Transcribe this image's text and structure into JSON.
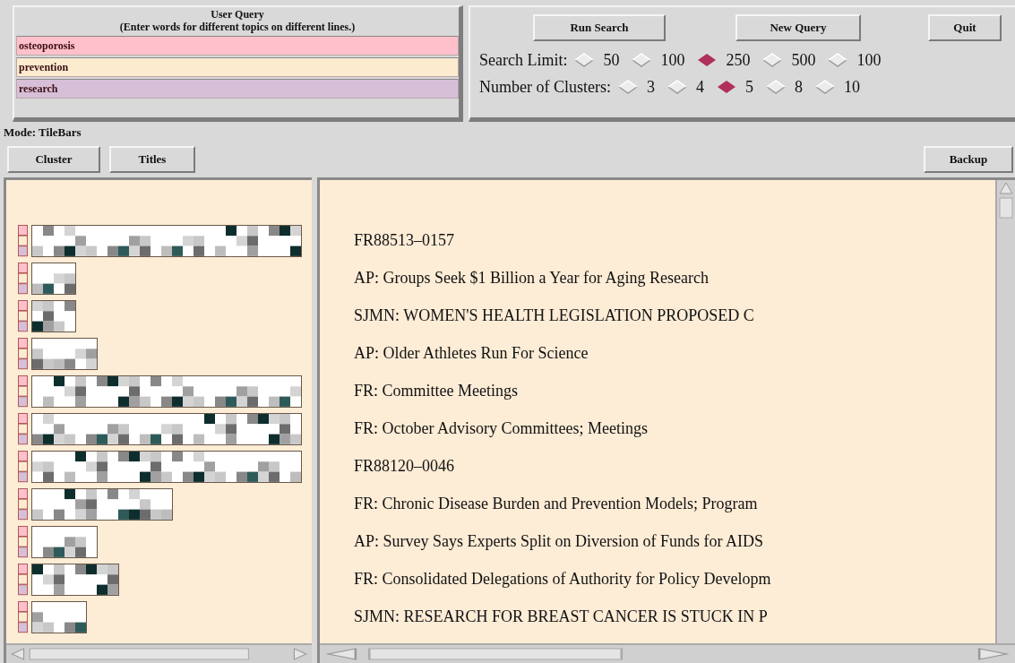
{
  "query_panel": {
    "title": "User Query",
    "hint": "(Enter words for different topics on different lines.)",
    "terms": [
      {
        "value": "osteoporosis",
        "color": "#ffc0cb"
      },
      {
        "value": "prevention",
        "color": "#fdebd0"
      },
      {
        "value": "research",
        "color": "#d8bfd8"
      }
    ]
  },
  "buttons": [
    "Run Search",
    "New Query",
    "Quit"
  ],
  "search_limit": {
    "label": "Search Limit:",
    "options": [
      {
        "label": "50",
        "selected": false
      },
      {
        "label": "100",
        "selected": false
      },
      {
        "label": "250",
        "selected": true
      },
      {
        "label": "500",
        "selected": false
      },
      {
        "label": "100",
        "selected": false
      }
    ]
  },
  "clusters": {
    "label": "Number of Clusters:",
    "options": [
      {
        "label": "3",
        "selected": false
      },
      {
        "label": "4",
        "selected": false
      },
      {
        "label": "5",
        "selected": true
      },
      {
        "label": "8",
        "selected": false
      },
      {
        "label": "10",
        "selected": false
      }
    ]
  },
  "mode": "Mode: TileBars",
  "view_buttons": [
    "Cluster",
    "Titles"
  ],
  "backup_button": "Backup",
  "documents": [
    {
      "title": "FR88513–0157"
    },
    {
      "title": "AP: Groups Seek $1 Billion a Year for Aging Research"
    },
    {
      "title": "SJMN: WOMEN'S HEALTH LEGISLATION PROPOSED C"
    },
    {
      "title": "AP: Older Athletes Run For Science"
    },
    {
      "title": "FR: Committee Meetings"
    },
    {
      "title": "FR: October Advisory Committees; Meetings"
    },
    {
      "title": "FR88120–0046"
    },
    {
      "title": "FR: Chronic Disease Burden and Prevention Models; Program"
    },
    {
      "title": "AP: Survey Says Experts Split on Diversion of Funds for AIDS"
    },
    {
      "title": "FR: Consolidated Delegations of Authority for Policy Developm"
    },
    {
      "title": "SJMN: RESEARCH FOR BREAST CANCER IS STUCK IN P"
    }
  ]
}
